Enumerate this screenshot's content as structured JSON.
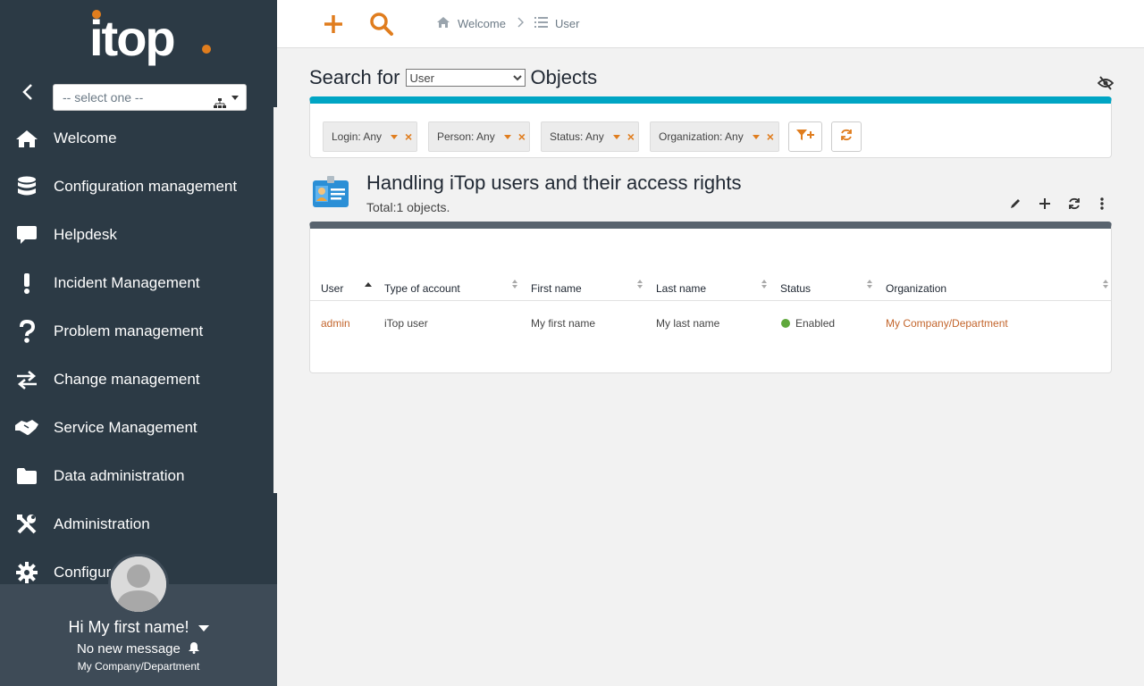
{
  "app": {
    "logo_text": "itop",
    "brand_color": "#e07d1e",
    "accent_color": "#00a5c4"
  },
  "sidebar": {
    "org_select_placeholder": "-- select one --",
    "items": [
      {
        "label": "Welcome",
        "icon": "home-icon"
      },
      {
        "label": "Configuration management",
        "icon": "database-icon"
      },
      {
        "label": "Helpdesk",
        "icon": "chat-bubble-icon"
      },
      {
        "label": "Incident Management",
        "icon": "exclamation-icon"
      },
      {
        "label": "Problem management",
        "icon": "question-icon"
      },
      {
        "label": "Change management",
        "icon": "exchange-arrows-icon"
      },
      {
        "label": "Service Management",
        "icon": "handshake-icon"
      },
      {
        "label": "Data administration",
        "icon": "folder-icon"
      },
      {
        "label": "Administration",
        "icon": "tools-icon"
      },
      {
        "label": "Configur",
        "icon": "gear-icon"
      }
    ],
    "user": {
      "greeting": "Hi My first name!",
      "messages": "No new message",
      "organization": "My Company/Department"
    }
  },
  "topbar": {
    "breadcrumb": [
      {
        "label": "Welcome",
        "icon": "home-icon"
      },
      {
        "label": "User",
        "icon": "list-icon"
      }
    ]
  },
  "search": {
    "prefix": "Search for",
    "class_selected": "User",
    "suffix": "Objects",
    "criteria": [
      {
        "label": "Login: Any"
      },
      {
        "label": "Person: Any"
      },
      {
        "label": "Status: Any"
      },
      {
        "label": "Organization: Any"
      }
    ]
  },
  "results": {
    "title": "Handling iTop users and their access rights",
    "total": "Total:1 objects.",
    "columns": [
      "User",
      "Type of account",
      "First name",
      "Last name",
      "Status",
      "Organization"
    ],
    "rows": [
      {
        "user": "admin",
        "type": "iTop user",
        "first_name": "My first name",
        "last_name": "My last name",
        "status": "Enabled",
        "organization": "My Company/Department"
      }
    ]
  }
}
